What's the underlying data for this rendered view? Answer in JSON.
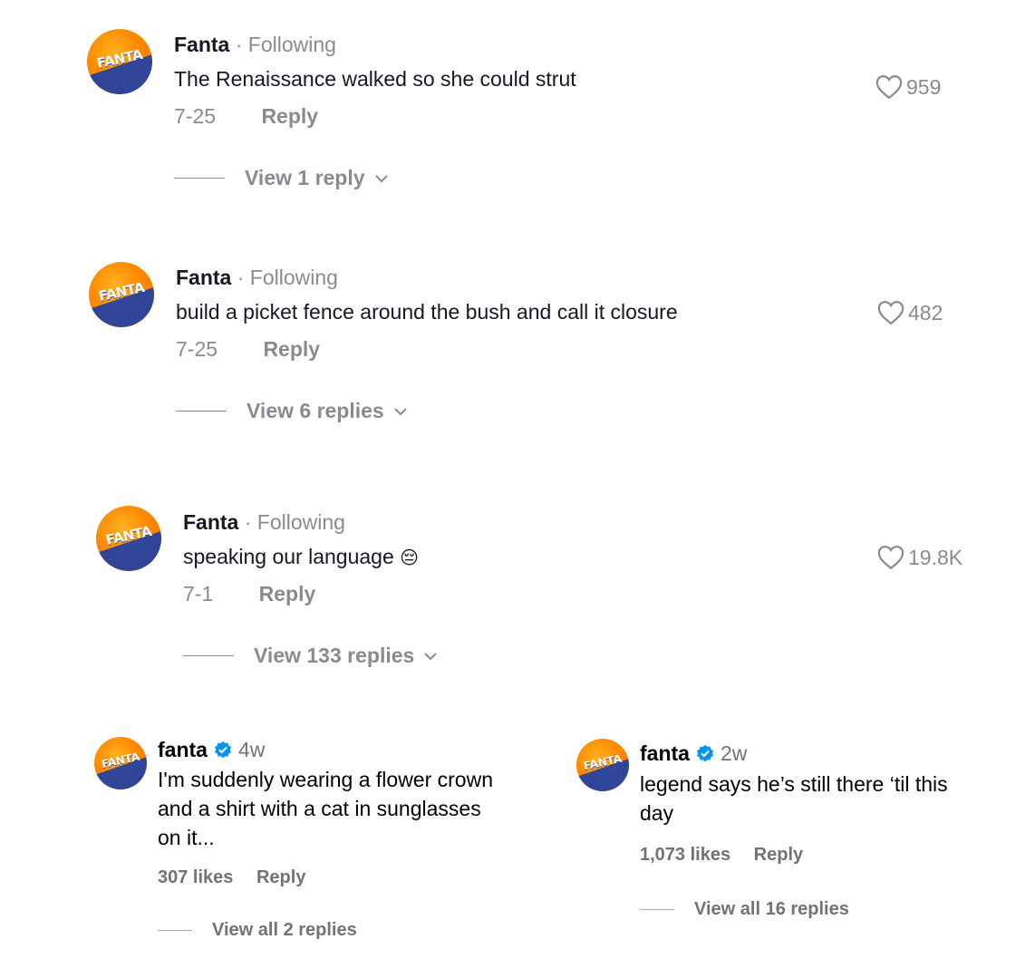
{
  "tiktok_comments": [
    {
      "username": "Fanta",
      "separator": "·",
      "follow_status": "Following",
      "text": "The Renaissance walked so she could strut",
      "date": "7-25",
      "reply_label": "Reply",
      "likes": "959",
      "view_replies": "View 1 reply"
    },
    {
      "username": "Fanta",
      "separator": "·",
      "follow_status": "Following",
      "text": "build a picket fence around the bush and call it closure",
      "date": "7-25",
      "reply_label": "Reply",
      "likes": "482",
      "view_replies": "View 6 replies"
    },
    {
      "username": "Fanta",
      "separator": "·",
      "follow_status": "Following",
      "text": "speaking our language",
      "emoji": "😔",
      "date": "7-1",
      "reply_label": "Reply",
      "likes": "19.8K",
      "view_replies": "View 133 replies"
    }
  ],
  "instagram_comments": [
    {
      "username": "fanta",
      "time": "4w",
      "text": "I'm suddenly wearing a flower crown and a shirt with a cat in sunglasses on it...",
      "likes": "307 likes",
      "reply_label": "Reply",
      "view_replies": "View all 2 replies"
    },
    {
      "username": "fanta",
      "time": "2w",
      "text": "legend says he’s still there ‘til this day",
      "likes": "1,073 likes",
      "reply_label": "Reply",
      "view_replies": "View all 16 replies"
    }
  ],
  "avatar_logo": "FANTA",
  "colors": {
    "brand_orange": "#ff8a00",
    "brand_blue": "#1a3ea8",
    "verified_blue": "#0095f6",
    "muted_text": "#8a8b91"
  }
}
